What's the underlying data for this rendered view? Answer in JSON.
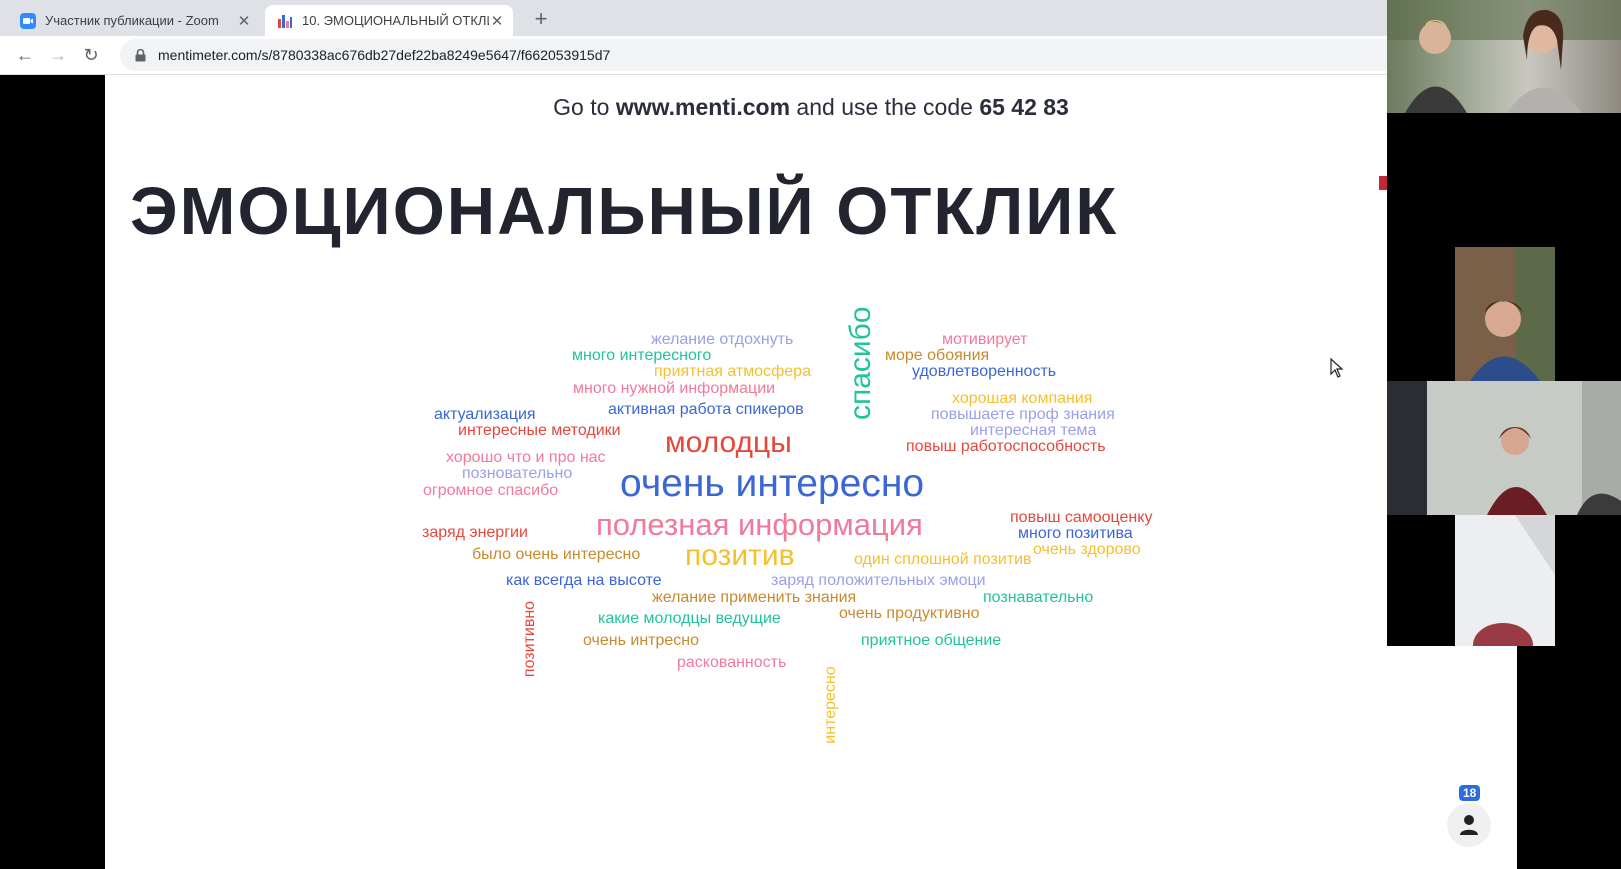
{
  "browser": {
    "tabs": [
      {
        "title": "Участник публикации - Zoom",
        "active": false
      },
      {
        "title": "10. ЭМОЦИОНАЛЬНЫЙ ОТКЛИ",
        "active": true
      }
    ],
    "url": "mentimeter.com/s/8780338ac676db27def22ba8249e5647/f662053915d7"
  },
  "slide": {
    "goto_prefix": "Go to ",
    "goto_site": "www.menti.com",
    "goto_mid": " and use the code ",
    "goto_code": "65 42 83",
    "title": "ЭМОЦИОНАЛЬНЫЙ ОТКЛИК",
    "participants": "18",
    "words": [
      {
        "text": "желание отдохнуть",
        "color": "#9aa0e6"
      },
      {
        "text": "много интересного",
        "color": "#22c39a"
      },
      {
        "text": "приятная атмосфера",
        "color": "#f5c02f"
      },
      {
        "text": "много нужной информации",
        "color": "#f07a9a"
      },
      {
        "text": "актуализация",
        "color": "#3a66d6"
      },
      {
        "text": "активная работа спикеров",
        "color": "#3a66d6"
      },
      {
        "text": "интересные методики",
        "color": "#e5473d"
      },
      {
        "text": "молодцы",
        "color": "#e5473d"
      },
      {
        "text": "спасибо",
        "color": "#22c39a"
      },
      {
        "text": "мотивирует",
        "color": "#f07a9a"
      },
      {
        "text": "море обояния",
        "color": "#c98a2c"
      },
      {
        "text": "удовлетворенность",
        "color": "#3a66d6"
      },
      {
        "text": "хорошая компания",
        "color": "#f5c02f"
      },
      {
        "text": "повышаете проф знания",
        "color": "#9aa0e6"
      },
      {
        "text": "интересная тема",
        "color": "#9aa0e6"
      },
      {
        "text": "повыш работоспособность",
        "color": "#e5473d"
      },
      {
        "text": "хорошо что и про нас",
        "color": "#f07a9a"
      },
      {
        "text": "позновательно",
        "color": "#9aa0e6"
      },
      {
        "text": "огромное спасибо",
        "color": "#f07a9a"
      },
      {
        "text": "очень интересно",
        "color": "#3a66d6"
      },
      {
        "text": "полезная информация",
        "color": "#f07a9a"
      },
      {
        "text": "позитив",
        "color": "#f5c02f"
      },
      {
        "text": "повыш самооценку",
        "color": "#e5473d"
      },
      {
        "text": "много позитива",
        "color": "#3a66d6"
      },
      {
        "text": "очень здорово",
        "color": "#f5c02f"
      },
      {
        "text": "заряд энергии",
        "color": "#e5473d"
      },
      {
        "text": "было очень интересно",
        "color": "#c98a2c"
      },
      {
        "text": "один сплошной позитив",
        "color": "#f5c02f"
      },
      {
        "text": "как всегда на высоте",
        "color": "#3a66d6"
      },
      {
        "text": "заряд положительных эмоци",
        "color": "#9aa0e6"
      },
      {
        "text": "желание применить знания",
        "color": "#c98a2c"
      },
      {
        "text": "познавательно",
        "color": "#22c39a"
      },
      {
        "text": "позитивно",
        "color": "#e5473d"
      },
      {
        "text": "какие молодцы ведущие",
        "color": "#22c39a"
      },
      {
        "text": "очень продуктивно",
        "color": "#c98a2c"
      },
      {
        "text": "очень интресно",
        "color": "#c98a2c"
      },
      {
        "text": "приятное общение",
        "color": "#22c39a"
      },
      {
        "text": "раскованность",
        "color": "#f07a9a"
      },
      {
        "text": "интересно",
        "color": "#f5c02f"
      }
    ]
  }
}
